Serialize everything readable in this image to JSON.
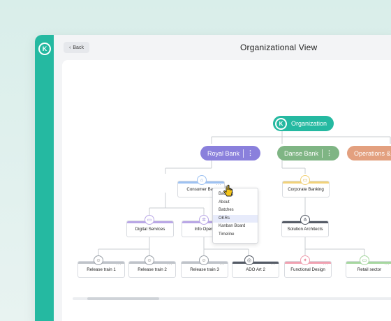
{
  "header": {
    "back_label": "Back",
    "title": "Organizational View"
  },
  "root": {
    "label": "Organization"
  },
  "level1": [
    {
      "label": "Royal Bank",
      "color": "#8a80dc"
    },
    {
      "label": "Danse Bank",
      "color": "#7fb584"
    },
    {
      "label": "Operations &",
      "color": "#e3a07f"
    }
  ],
  "cards": {
    "consumer_banking": "Consumer Ban",
    "corporate_banking": "Corporate Banking",
    "digital_services": "Digital Services",
    "info_operations": "Info Operat",
    "solution_architects": "Solution Architects",
    "release_train_1": "Release train 1",
    "release_train_2": "Release train 2",
    "release_train_3": "Release train 3",
    "ado_art_2": "ADO Art 2",
    "functional_design": "Functional Design",
    "retail_sector": "Retail sector"
  },
  "context_menu": {
    "items": [
      "Backlog",
      "About",
      "Batches",
      "OKRs",
      "Kanban Board",
      "Timeline"
    ],
    "selected": "OKRs"
  },
  "colors": {
    "accent": "#25b9a1",
    "blue": "#9ec2f2",
    "yellow": "#f2d27a",
    "purple": "#b9a7e6",
    "gray": "#bfc3c9",
    "dark": "#555b66",
    "pink": "#f0a1b1",
    "green": "#a6d79f"
  }
}
